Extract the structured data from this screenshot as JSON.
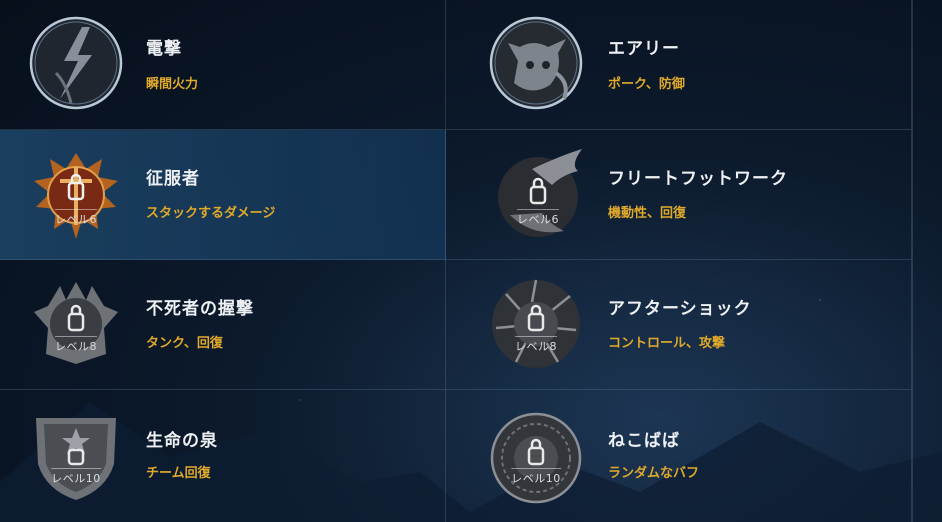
{
  "runes": [
    {
      "name": "電撃",
      "desc": "瞬間火力",
      "level": "",
      "icon": "lightning-icon",
      "state": "owned"
    },
    {
      "name": "エアリー",
      "desc": "ポーク、防御",
      "level": "",
      "icon": "fairy-cat-icon",
      "state": "owned"
    },
    {
      "name": "征服者",
      "desc": "スタックするダメージ",
      "level": "レベル6",
      "icon": "conqueror-icon",
      "state": "selected-locked"
    },
    {
      "name": "フリートフットワーク",
      "desc": "機動性、回復",
      "level": "レベル6",
      "icon": "wing-icon",
      "state": "locked"
    },
    {
      "name": "不死者の握撃",
      "desc": "タンク、回復",
      "level": "レベル8",
      "icon": "grasp-icon",
      "state": "locked"
    },
    {
      "name": "アフターショック",
      "desc": "コントロール、攻撃",
      "level": "レベル8",
      "icon": "aftershock-icon",
      "state": "locked"
    },
    {
      "name": "生命の泉",
      "desc": "チーム回復",
      "level": "レベル10",
      "icon": "shield-icon",
      "state": "locked"
    },
    {
      "name": "ねこばば",
      "desc": "ランダムなバフ",
      "level": "レベル10",
      "icon": "coin-icon",
      "state": "locked"
    }
  ],
  "colors": {
    "accent": "#e0a92a",
    "selected_bg": "#1e4669",
    "title": "#eef1f4",
    "conqueror_gold": "#c8752a"
  }
}
